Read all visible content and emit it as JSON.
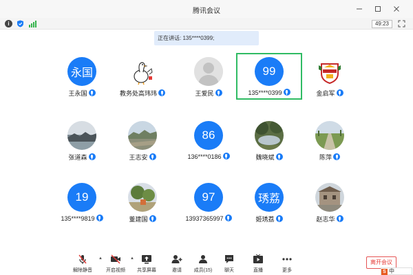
{
  "window": {
    "title": "腾讯会议",
    "controls": {
      "minimize_icon": "minimize-icon",
      "maximize_icon": "maximize-icon",
      "close_icon": "close-icon"
    }
  },
  "info_bar": {
    "icons": [
      "info-icon",
      "shield-icon",
      "signal-icon",
      "fullscreen-icon"
    ],
    "timer": "49:23"
  },
  "speaking": {
    "text": "正在讲话: 135****0399;"
  },
  "participants": [
    {
      "name": "王永国",
      "avatar_text": "永国",
      "avatar_type": "text"
    },
    {
      "name": "教务处高玮玮",
      "avatar_type": "image",
      "image": "cartoon-goose"
    },
    {
      "name": "王爱民",
      "avatar_type": "placeholder"
    },
    {
      "name": "135****0399",
      "avatar_text": "99",
      "avatar_type": "text",
      "active": true
    },
    {
      "name": "金启军",
      "avatar_type": "image",
      "image": "school-emblem"
    },
    {
      "name": "张道森",
      "avatar_type": "image",
      "image": "coast-photo"
    },
    {
      "name": "王志安",
      "avatar_type": "image",
      "image": "landscape-photo"
    },
    {
      "name": "136****0186",
      "avatar_text": "86",
      "avatar_type": "text"
    },
    {
      "name": "魏晓斌",
      "avatar_type": "image",
      "image": "pond-photo"
    },
    {
      "name": "陈萍",
      "avatar_type": "image",
      "image": "field-photo"
    },
    {
      "name": "135****9819",
      "avatar_text": "19",
      "avatar_type": "text"
    },
    {
      "name": "董建国",
      "avatar_type": "image",
      "image": "garden-photo"
    },
    {
      "name": "13937365997",
      "avatar_text": "97",
      "avatar_type": "text"
    },
    {
      "name": "姬琇荔",
      "avatar_text": "琇荔",
      "avatar_type": "text"
    },
    {
      "name": "赵志华",
      "avatar_type": "image",
      "image": "building-photo"
    }
  ],
  "toolbar": {
    "unmute": "解除静音",
    "start_video": "开启视频",
    "share_screen": "共享屏幕",
    "invite": "邀请",
    "members": "成员(15)",
    "chat": "聊天",
    "live": "直播",
    "more": "更多",
    "leave": "离开会议"
  },
  "ime": {
    "text": "中"
  },
  "colors": {
    "accent": "#1a7cf7",
    "active_border": "#2fbb63",
    "leave": "#e53935"
  }
}
